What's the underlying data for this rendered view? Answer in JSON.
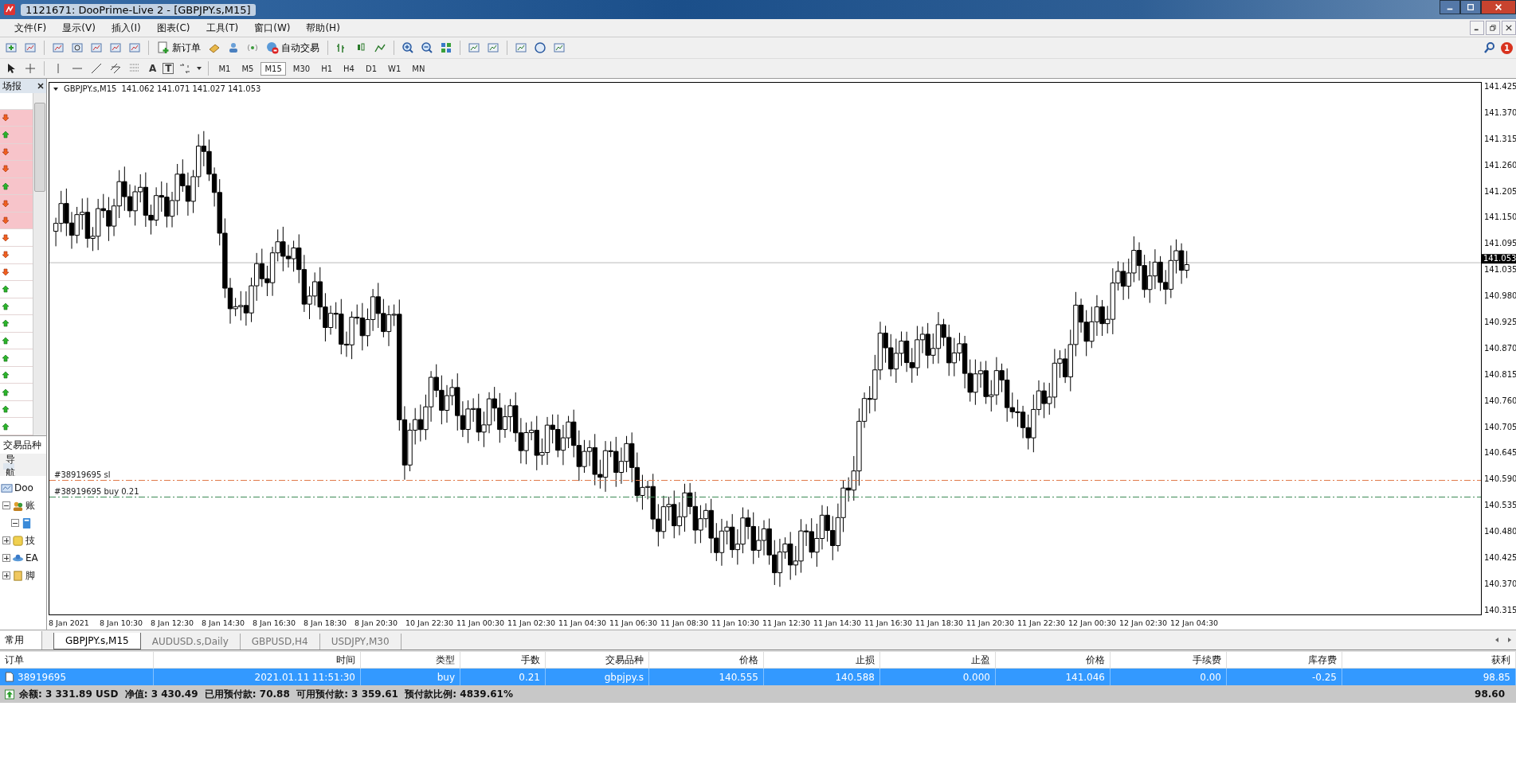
{
  "window": {
    "title": "1121671: DooPrime-Live 2 - [GBPJPY.s,M15]"
  },
  "menu": [
    "文件(F)",
    "显示(V)",
    "插入(I)",
    "图表(C)",
    "工具(T)",
    "窗口(W)",
    "帮助(H)"
  ],
  "toolbar": {
    "new_order": "新订单",
    "auto_trading": "自动交易",
    "notification_count": "1"
  },
  "drawing_tools": {
    "label_tool": "A",
    "text_tool": "T"
  },
  "timeframes": [
    {
      "label": "M1",
      "selected": false
    },
    {
      "label": "M5",
      "selected": false
    },
    {
      "label": "M15",
      "selected": true
    },
    {
      "label": "M30",
      "selected": false
    },
    {
      "label": "H1",
      "selected": false
    },
    {
      "label": "H4",
      "selected": false
    },
    {
      "label": "D1",
      "selected": false
    },
    {
      "label": "W1",
      "selected": false
    },
    {
      "label": "MN",
      "selected": false
    }
  ],
  "market_watch": {
    "title": "场报",
    "tab": "交易品种",
    "rows": [
      {
        "kind": "down",
        "highlighted": true
      },
      {
        "kind": "up",
        "highlighted": true
      },
      {
        "kind": "down",
        "highlighted": true
      },
      {
        "kind": "down",
        "highlighted": true
      },
      {
        "kind": "up",
        "highlighted": true
      },
      {
        "kind": "down",
        "highlighted": true
      },
      {
        "kind": "down",
        "highlighted": true
      },
      {
        "kind": "down",
        "highlighted": false
      },
      {
        "kind": "down",
        "highlighted": false
      },
      {
        "kind": "down",
        "highlighted": false
      },
      {
        "kind": "up",
        "highlighted": false
      },
      {
        "kind": "up",
        "highlighted": false
      },
      {
        "kind": "up",
        "highlighted": false
      },
      {
        "kind": "up",
        "highlighted": false
      },
      {
        "kind": "up",
        "highlighted": false
      },
      {
        "kind": "up",
        "highlighted": false
      },
      {
        "kind": "up",
        "highlighted": false
      },
      {
        "kind": "up",
        "highlighted": false
      },
      {
        "kind": "up",
        "highlighted": false
      }
    ]
  },
  "navigator": {
    "title": "导航",
    "items": [
      {
        "label": "Doo",
        "kind": "server",
        "children": [
          {
            "label": "账",
            "kind": "accounts",
            "expanded": true,
            "children": [
              {
                "kind": "account",
                "expanded": true
              }
            ]
          },
          {
            "label": "技",
            "kind": "indicators",
            "expanded": false
          },
          {
            "label": "EA",
            "kind": "experts",
            "expanded": false
          },
          {
            "label": "脚",
            "kind": "scripts",
            "expanded": false
          }
        ]
      }
    ]
  },
  "left_tab": "常用",
  "chart": {
    "header": "GBPJPY.s,M15",
    "ohlc": "141.062 141.071 141.027 141.053",
    "current_price": "141.053",
    "price_ticks": [
      "141.425",
      "141.370",
      "141.315",
      "141.260",
      "141.205",
      "141.150",
      "141.095",
      "141.035",
      "140.980",
      "140.925",
      "140.870",
      "140.815",
      "140.760",
      "140.705",
      "140.645",
      "140.590",
      "140.535",
      "140.480",
      "140.425",
      "140.370",
      "140.315"
    ],
    "time_labels": [
      "8 Jan 2021",
      "8 Jan 10:30",
      "8 Jan 12:30",
      "8 Jan 14:30",
      "8 Jan 16:30",
      "8 Jan 18:30",
      "8 Jan 20:30",
      "10 Jan 22:30",
      "11 Jan 00:30",
      "11 Jan 02:30",
      "11 Jan 04:30",
      "11 Jan 06:30",
      "11 Jan 08:30",
      "11 Jan 10:30",
      "11 Jan 12:30",
      "11 Jan 14:30",
      "11 Jan 16:30",
      "11 Jan 18:30",
      "11 Jan 20:30",
      "11 Jan 22:30",
      "12 Jan 00:30",
      "12 Jan 02:30",
      "12 Jan 04:30"
    ],
    "order_lines": [
      {
        "label": "#38919695 sl",
        "kind": "sl",
        "color": "#e07a4a"
      },
      {
        "label": "#38919695 buy 0.21",
        "kind": "buy",
        "color": "#3d8a55"
      }
    ]
  },
  "chart_tabs": [
    {
      "label": "GBPJPY.s,M15",
      "selected": true
    },
    {
      "label": "AUDUSD.s,Daily",
      "selected": false
    },
    {
      "label": "GBPUSD,H4",
      "selected": false
    },
    {
      "label": "USDJPY,M30",
      "selected": false
    }
  ],
  "terminal": {
    "columns": [
      "订单",
      "时间",
      "类型",
      "手数",
      "交易品种",
      "价格",
      "止损",
      "止盈",
      "价格",
      "手续费",
      "库存费",
      "获利"
    ],
    "rows": [
      {
        "selected": true,
        "cells": [
          "38919695",
          "2021.01.11 11:51:30",
          "buy",
          "0.21",
          "gbpjpy.s",
          "140.555",
          "140.588",
          "0.000",
          "141.046",
          "0.00",
          "-0.25",
          "98.85"
        ]
      }
    ],
    "summary": "余额: 3 331.89 USD  净值: 3 430.49  已用预付款: 70.88  可用预付款: 3 359.61  预付款比例: 4839.61%",
    "summary_total": "98.60"
  }
}
